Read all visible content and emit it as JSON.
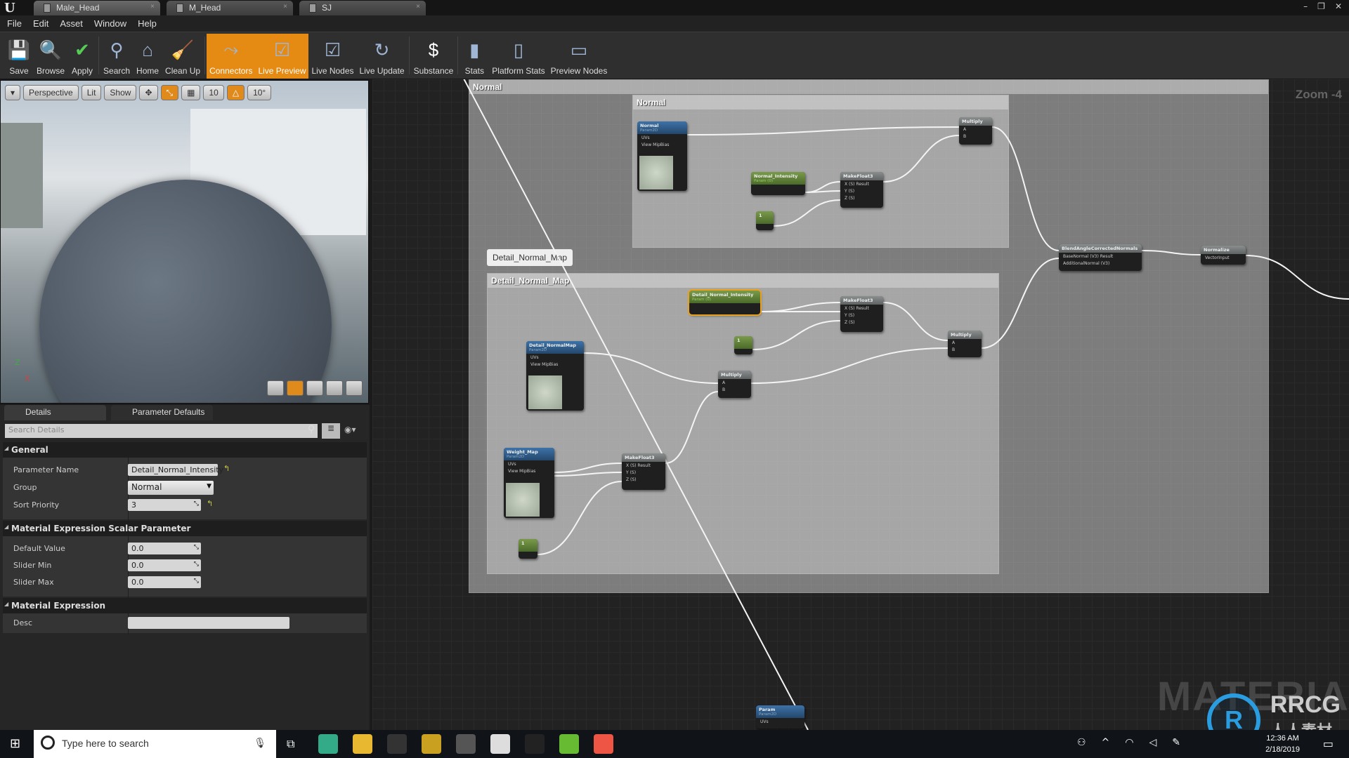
{
  "tabs": [
    {
      "label": "Male_Head"
    },
    {
      "label": "M_Head"
    },
    {
      "label": "SJ"
    }
  ],
  "menu": [
    "File",
    "Edit",
    "Asset",
    "Window",
    "Help"
  ],
  "toolbar": [
    {
      "label": "Save",
      "icon": "save-icon",
      "active": false
    },
    {
      "label": "Browse",
      "icon": "browse-icon",
      "active": false
    },
    {
      "label": "Apply",
      "icon": "apply-icon",
      "active": false
    },
    {
      "label": "Search",
      "icon": "search-icon",
      "active": false
    },
    {
      "label": "Home",
      "icon": "home-icon",
      "active": false
    },
    {
      "label": "Clean Up",
      "icon": "cleanup-icon",
      "active": false
    },
    {
      "label": "Connectors",
      "icon": "connectors-icon",
      "active": true
    },
    {
      "label": "Live Preview",
      "icon": "live-preview-icon",
      "active": true
    },
    {
      "label": "Live Nodes",
      "icon": "live-nodes-icon",
      "active": false
    },
    {
      "label": "Live Update",
      "icon": "live-update-icon",
      "active": false
    },
    {
      "label": "Substance",
      "icon": "substance-icon",
      "active": false
    },
    {
      "label": "Stats",
      "icon": "stats-icon",
      "active": false
    },
    {
      "label": "Platform Stats",
      "icon": "platform-stats-icon",
      "active": false
    },
    {
      "label": "Preview Nodes",
      "icon": "preview-nodes-icon",
      "active": false
    }
  ],
  "viewport": {
    "perspective": "Perspective",
    "lit": "Lit",
    "show": "Show",
    "grid_snap": "10",
    "rot_snap": "10°",
    "axis_z": "Z",
    "axis_x": "X"
  },
  "details": {
    "tabs": [
      "Details",
      "Parameter Defaults"
    ],
    "search_placeholder": "Search Details",
    "general": {
      "title": "General",
      "param_name_label": "Parameter Name",
      "param_name": "Detail_Normal_Intensity",
      "group_label": "Group",
      "group": "Normal",
      "sort_label": "Sort Priority",
      "sort": "3"
    },
    "scalar": {
      "title": "Material Expression Scalar Parameter",
      "default_label": "Default Value",
      "default": "0.0",
      "min_label": "Slider Min",
      "min": "0.0",
      "max_label": "Slider Max",
      "max": "0.0"
    },
    "expr": {
      "title": "Material Expression",
      "desc_label": "Desc",
      "desc": ""
    }
  },
  "graph": {
    "zoom": "Zoom -4",
    "watermark": "MATERIAL",
    "comments": {
      "outer": "Normal",
      "inner": "Normal",
      "detail": "Detail_Normal_Map",
      "detail_bubble": "Detail_Normal_Map"
    },
    "nodes": [
      {
        "id": "n_normal",
        "kind": "blue",
        "title": "Normal",
        "sub": "Param2D",
        "pins": [
          "UVs",
          "View MipBias"
        ],
        "tex": true
      },
      {
        "id": "n_nint",
        "kind": "green",
        "title": "Normal_Intensity",
        "sub": "Param (0)",
        "pins": []
      },
      {
        "id": "n_c1",
        "kind": "green",
        "title": "1",
        "pins": []
      },
      {
        "id": "n_mf1",
        "kind": "gray",
        "title": "MakeFloat3",
        "pins": [
          "X (S) Result",
          "Y (S)",
          "Z (S)"
        ]
      },
      {
        "id": "n_mul1",
        "kind": "gray",
        "title": "Multiply",
        "pins": [
          "A",
          "B"
        ]
      },
      {
        "id": "n_blend",
        "kind": "gray",
        "title": "BlendAngleCorrectedNormals",
        "pins": [
          "BaseNormal (V3)   Result",
          "AdditionalNormal (V3)"
        ]
      },
      {
        "id": "n_norm",
        "kind": "gray",
        "title": "Normalize",
        "pins": [
          "VectorInput"
        ]
      },
      {
        "id": "n_dni",
        "kind": "green",
        "title": "Detail_Normal_Intensity",
        "sub": "Param (0)",
        "pins": [],
        "selected": true
      },
      {
        "id": "n_dnm",
        "kind": "blue",
        "title": "Detail_NormalMap",
        "sub": "Param2D",
        "pins": [
          "UVs",
          "View MipBias"
        ],
        "tex": true
      },
      {
        "id": "n_c2",
        "kind": "green",
        "title": "1",
        "pins": []
      },
      {
        "id": "n_mf2",
        "kind": "gray",
        "title": "MakeFloat3",
        "pins": [
          "X (S) Result",
          "Y (S)",
          "Z (S)"
        ]
      },
      {
        "id": "n_mul2",
        "kind": "gray",
        "title": "Multiply",
        "pins": [
          "A",
          "B"
        ]
      },
      {
        "id": "n_mul3",
        "kind": "gray",
        "title": "Multiply",
        "pins": [
          "A",
          "B"
        ]
      },
      {
        "id": "n_wm",
        "kind": "blue",
        "title": "Weight_Map",
        "sub": "Param2D",
        "pins": [
          "UVs",
          "View MipBias"
        ],
        "tex": true
      },
      {
        "id": "n_mf3",
        "kind": "gray",
        "title": "MakeFloat3",
        "pins": [
          "X (S) Result",
          "Y (S)",
          "Z (S)"
        ]
      },
      {
        "id": "n_c3",
        "kind": "green",
        "title": "1",
        "pins": []
      },
      {
        "id": "n_param",
        "kind": "blue",
        "title": "Param",
        "sub": "Param2D",
        "pins": [
          "UVs"
        ]
      }
    ]
  },
  "taskbar": {
    "search_placeholder": "Type here to search",
    "time": "12:36 AM",
    "date": "2/18/2019",
    "apps": [
      "chrome",
      "file-explorer",
      "unreal-engine",
      "marmoset",
      "davinci",
      "zbrush",
      "epic-games",
      "camtasia-green",
      "camtasia-orange"
    ]
  },
  "branding": {
    "logo_text": "RRCG",
    "logo_sub": "人人素材"
  }
}
